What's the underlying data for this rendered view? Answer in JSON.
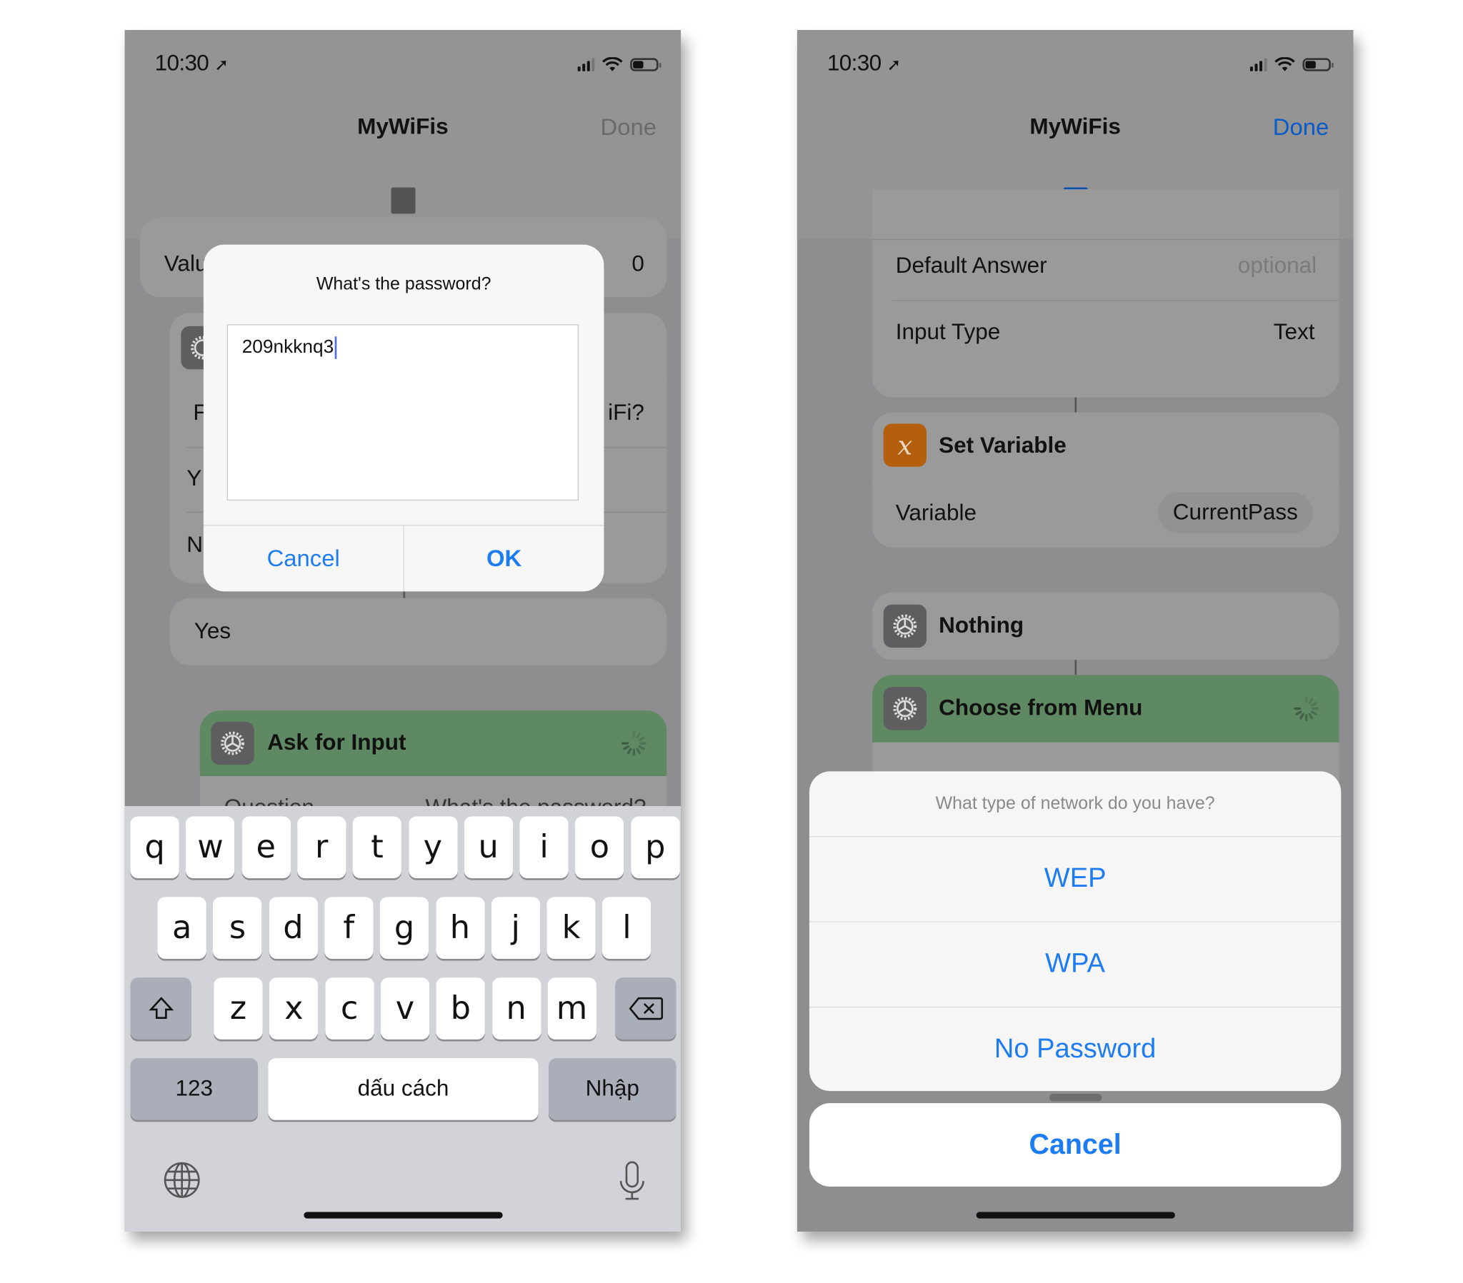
{
  "colors": {
    "accent_blue": "#1e7cf2",
    "done_blue": "#0a5ac8",
    "action_green": "#5f8962",
    "variable_orange": "#b45f0e",
    "dimmed_overlay": "#8e8e90"
  },
  "left_phone": {
    "status_bar": {
      "time": "10:30",
      "location_icon": "location-arrow-icon",
      "signal_icon": "cellular-signal-icon",
      "wifi_icon": "wifi-icon",
      "battery_icon": "battery-icon"
    },
    "nav": {
      "title": "MyWiFis",
      "done_label": "Done",
      "done_enabled": false,
      "run_indicator_icon": "stop-square-icon"
    },
    "background_cards": {
      "value_row": {
        "label": "Valu",
        "value": "0"
      },
      "question_row_partial_left": "F",
      "question_row_partial_right": "iFi?",
      "option_partial_1": "Y",
      "option_partial_2": "N",
      "yes_card": "Yes",
      "ask_for_input": {
        "title": "Ask for Input",
        "question_label": "Question",
        "question_value": "What's the password?"
      }
    },
    "dialog": {
      "title": "What's the password?",
      "input_value": "209nkknq3",
      "cancel_label": "Cancel",
      "ok_label": "OK"
    },
    "keyboard": {
      "row1": [
        "q",
        "w",
        "e",
        "r",
        "t",
        "y",
        "u",
        "i",
        "o",
        "p"
      ],
      "row2": [
        "a",
        "s",
        "d",
        "f",
        "g",
        "h",
        "j",
        "k",
        "l"
      ],
      "row3": [
        "z",
        "x",
        "c",
        "v",
        "b",
        "n",
        "m"
      ],
      "shift_icon": "shift-arrow-icon",
      "delete_icon": "delete-backspace-icon",
      "numbers_label": "123",
      "space_label": "dấu cách",
      "return_label": "Nhập",
      "globe_icon": "globe-icon",
      "mic_icon": "microphone-icon"
    }
  },
  "right_phone": {
    "status_bar": {
      "time": "10:30",
      "location_icon": "location-arrow-icon",
      "signal_icon": "cellular-signal-icon",
      "wifi_icon": "wifi-icon",
      "battery_icon": "battery-icon"
    },
    "nav": {
      "title": "MyWiFis",
      "done_label": "Done",
      "done_enabled": true,
      "run_indicator_icon": "stop-square-icon"
    },
    "ask_for_input_card": {
      "rows": [
        {
          "label": "Default Answer",
          "value": "optional",
          "is_placeholder": true
        },
        {
          "label": "Input Type",
          "value": "Text",
          "is_placeholder": false
        }
      ]
    },
    "set_variable_card": {
      "title": "Set Variable",
      "icon_glyph": "x",
      "variable_label": "Variable",
      "variable_value": "CurrentPass"
    },
    "nothing_card": {
      "title": "Nothing"
    },
    "choose_menu_card": {
      "title": "Choose from Menu"
    },
    "action_sheet": {
      "title": "What type of network do you have?",
      "options": [
        "WEP",
        "WPA",
        "No Password"
      ],
      "cancel_label": "Cancel"
    }
  }
}
